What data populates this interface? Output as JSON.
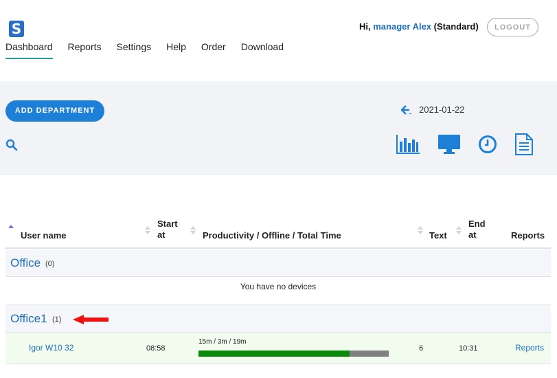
{
  "header": {
    "logo_letter": "S",
    "nav": [
      {
        "label": "Dashboard",
        "active": true
      },
      {
        "label": "Reports",
        "active": false
      },
      {
        "label": "Settings",
        "active": false
      },
      {
        "label": "Help",
        "active": false
      },
      {
        "label": "Order",
        "active": false
      },
      {
        "label": "Download",
        "active": false
      }
    ],
    "greeting_prefix": "Hi,",
    "greeting_user": "manager Alex",
    "greeting_plan": "(Standard)",
    "logout_label": "LOGOUT"
  },
  "toolbar": {
    "add_department_label": "ADD DEPARTMENT",
    "date": "2021-01-22",
    "icons": [
      "bar-chart-icon",
      "monitor-icon",
      "clock-icon",
      "document-icon"
    ]
  },
  "table": {
    "columns": {
      "user_name": "User name",
      "start_at": [
        "Start",
        "at"
      ],
      "productivity": "Productivity / Offline / Total Time",
      "text": "Text",
      "end_at": [
        "End",
        "at"
      ],
      "reports": "Reports"
    },
    "departments": [
      {
        "name": "Office",
        "count": "(0)",
        "empty_message": "You have no devices"
      },
      {
        "name": "Office1",
        "count": "(1)"
      }
    ],
    "rows": [
      {
        "user": "Igor W10 32",
        "start": "08:58",
        "productivity_text": "15m / 3m / 19m",
        "productive_fraction": 0.795,
        "text": "6",
        "end": "10:31",
        "reports_label": "Reports"
      }
    ]
  },
  "colors": {
    "accent_blue": "#1e7fd6",
    "link_blue": "#1f6fbf",
    "productive_green": "#0a8a0a",
    "offline_gray": "#808080",
    "arrow_red": "#ee1111"
  }
}
